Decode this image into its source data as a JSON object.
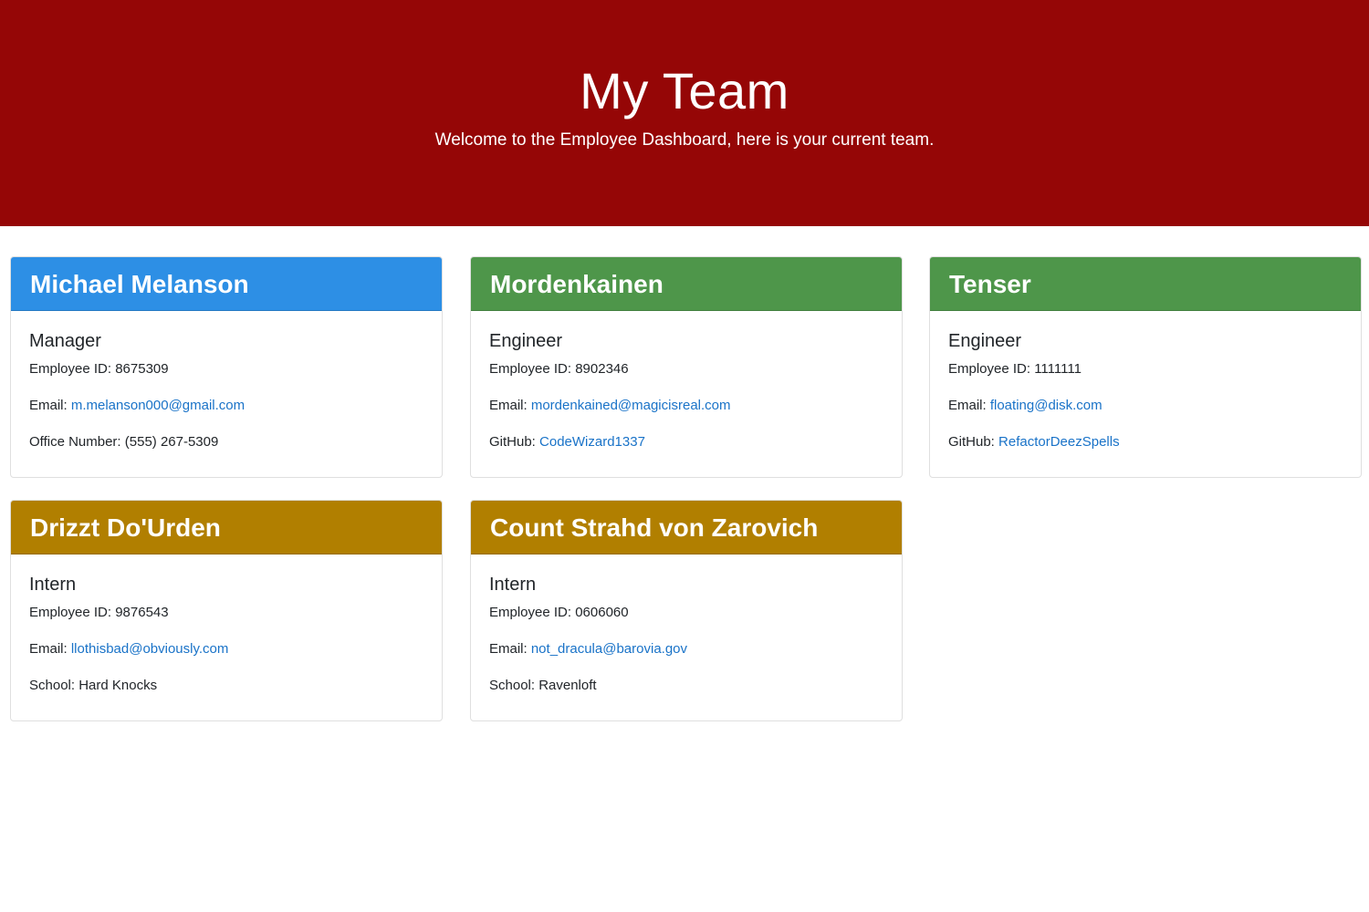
{
  "header": {
    "title": "My Team",
    "subtitle": "Welcome to the Employee Dashboard, here is your current team."
  },
  "colors": {
    "hero": "#950606",
    "manager": "#2d8fe5",
    "engineer": "#4e964a",
    "intern": "#b17f00",
    "link": "#1a73c8"
  },
  "employees": [
    {
      "name": "Michael Melanson",
      "role": "Manager",
      "id_label": "Employee ID: 8675309",
      "email_label": "Email: ",
      "email": "m.melanson000@gmail.com",
      "extra_label": "Office Number: (555) 267-5309",
      "extra_link": ""
    },
    {
      "name": "Mordenkainen",
      "role": "Engineer",
      "id_label": "Employee ID: 8902346",
      "email_label": "Email: ",
      "email": "mordenkained@magicisreal.com",
      "extra_label": "GitHub: ",
      "extra_link": "CodeWizard1337"
    },
    {
      "name": "Tenser",
      "role": "Engineer",
      "id_label": "Employee ID: 1111111",
      "email_label": "Email: ",
      "email": "floating@disk.com",
      "extra_label": "GitHub: ",
      "extra_link": "RefactorDeezSpells"
    },
    {
      "name": "Drizzt Do'Urden",
      "role": "Intern",
      "id_label": "Employee ID: 9876543",
      "email_label": "Email: ",
      "email": "llothisbad@obviously.com",
      "extra_label": "School: Hard Knocks",
      "extra_link": ""
    },
    {
      "name": "Count Strahd von Zarovich",
      "role": "Intern",
      "id_label": "Employee ID: 0606060",
      "email_label": "Email: ",
      "email": "not_dracula@barovia.gov",
      "extra_label": "School: Ravenloft",
      "extra_link": ""
    }
  ]
}
